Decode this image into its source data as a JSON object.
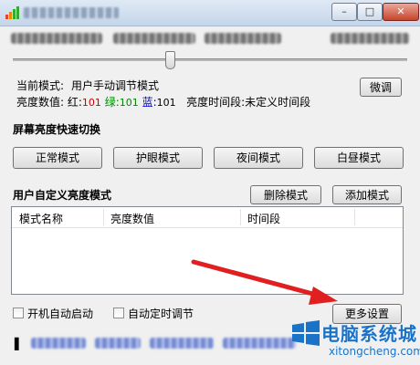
{
  "colors": {
    "red_value": "#cc0000",
    "green_value": "#008800",
    "blue_value": "#0000cc",
    "arrow": "#e02020",
    "watermark": "#1a73c9"
  },
  "titlebar": {
    "minimize_icon": "minimize-icon",
    "maximize_icon": "maximize-icon",
    "close_icon": "close-icon",
    "minimize_glyph": "–",
    "maximize_glyph": "□",
    "close_glyph": "✕"
  },
  "brightness": {
    "slider_level": 0.4
  },
  "status": {
    "mode_label": "当前模式:",
    "mode_value": "用户手动调节模式",
    "fine_tune_button": "微调",
    "value_label": "亮度数值:",
    "red_label": "红:",
    "red_value": "101",
    "green_label": "绿:",
    "green_value": "101",
    "blue_label": "蓝:",
    "blue_value": "101",
    "period_label": "亮度时间段:",
    "period_value": "未定义时间段"
  },
  "quick_switch": {
    "heading": "屏幕亮度快速切换",
    "buttons": [
      "正常模式",
      "护眼模式",
      "夜间模式",
      "白昼模式"
    ]
  },
  "custom": {
    "heading": "用户自定义亮度模式",
    "delete_button": "删除模式",
    "add_button": "添加模式",
    "columns": [
      "模式名称",
      "亮度数值",
      "时间段"
    ]
  },
  "options": {
    "autostart_label": "开机自动启动",
    "autotimer_label": "自动定时调节",
    "more_settings_button": "更多设置"
  },
  "watermark": {
    "text": "电脑系统城",
    "url": "xitongcheng.com"
  }
}
